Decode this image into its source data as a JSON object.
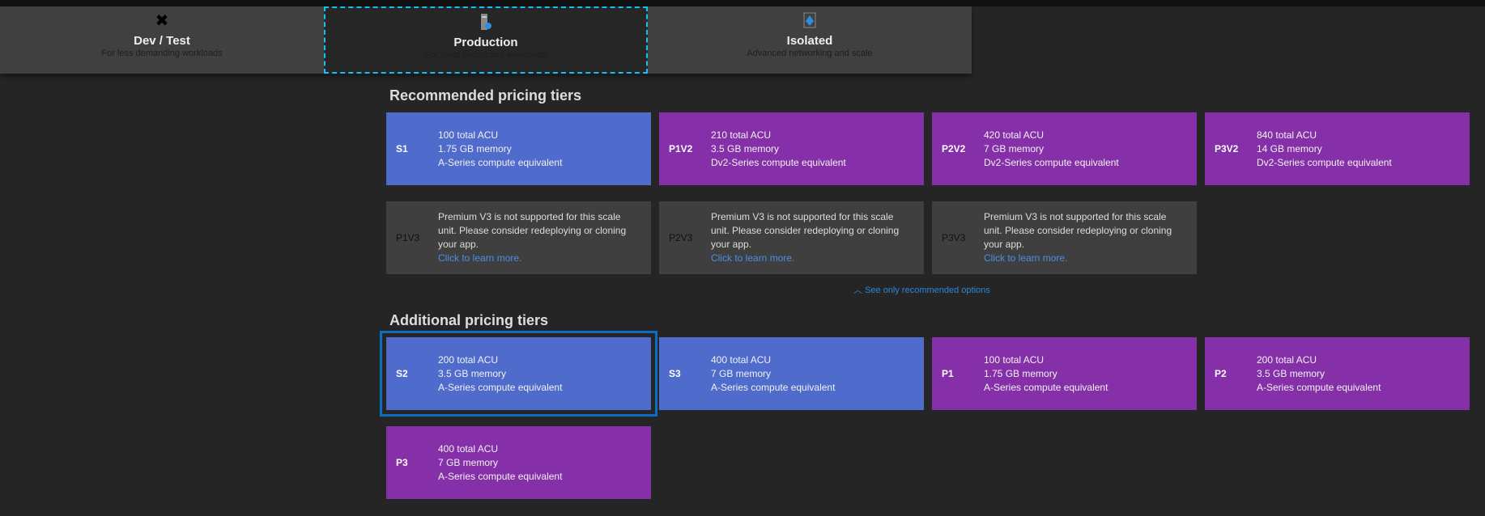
{
  "tabs": [
    {
      "title": "Dev / Test",
      "subtitle": "For less demanding workloads",
      "icon": "tools-icon",
      "selected": false
    },
    {
      "title": "Production",
      "subtitle": "For most production workloads",
      "icon": "server-icon",
      "selected": true
    },
    {
      "title": "Isolated",
      "subtitle": "Advanced networking and scale",
      "icon": "isolated-icon",
      "selected": false
    }
  ],
  "recommended": {
    "heading": "Recommended pricing tiers",
    "tiers": [
      {
        "name": "S1",
        "l1": "100 total ACU",
        "l2": "1.75 GB memory",
        "l3": "A-Series compute equivalent",
        "color": "#4f6bcb"
      },
      {
        "name": "P1V2",
        "l1": "210 total ACU",
        "l2": "3.5 GB memory",
        "l3": "Dv2-Series compute equivalent",
        "color": "#8530a8"
      },
      {
        "name": "P2V2",
        "l1": "420 total ACU",
        "l2": "7 GB memory",
        "l3": "Dv2-Series compute equivalent",
        "color": "#8530a8"
      },
      {
        "name": "P3V2",
        "l1": "840 total ACU",
        "l2": "14 GB memory",
        "l3": "Dv2-Series compute equivalent",
        "color": "#8530a8"
      }
    ],
    "unsupported": [
      {
        "name": "P1V3",
        "msg": "Premium V3 is not supported for this scale unit. Please consider redeploying or cloning your app.",
        "link": "Click to learn more."
      },
      {
        "name": "P2V3",
        "msg": "Premium V3 is not supported for this scale unit. Please consider redeploying or cloning your app.",
        "link": "Click to learn more."
      },
      {
        "name": "P3V3",
        "msg": "Premium V3 is not supported for this scale unit. Please consider redeploying or cloning your app.",
        "link": "Click to learn more."
      }
    ],
    "see_only": "See only recommended options"
  },
  "additional": {
    "heading": "Additional pricing tiers",
    "tiers": [
      {
        "name": "S2",
        "l1": "200 total ACU",
        "l2": "3.5 GB memory",
        "l3": "A-Series compute equivalent",
        "color": "#4f6bcb",
        "selected": true
      },
      {
        "name": "S3",
        "l1": "400 total ACU",
        "l2": "7 GB memory",
        "l3": "A-Series compute equivalent",
        "color": "#4f6bcb"
      },
      {
        "name": "P1",
        "l1": "100 total ACU",
        "l2": "1.75 GB memory",
        "l3": "A-Series compute equivalent",
        "color": "#8530a8"
      },
      {
        "name": "P2",
        "l1": "200 total ACU",
        "l2": "3.5 GB memory",
        "l3": "A-Series compute equivalent",
        "color": "#8530a8"
      },
      {
        "name": "P3",
        "l1": "400 total ACU",
        "l2": "7 GB memory",
        "l3": "A-Series compute equivalent",
        "color": "#8530a8"
      }
    ]
  }
}
